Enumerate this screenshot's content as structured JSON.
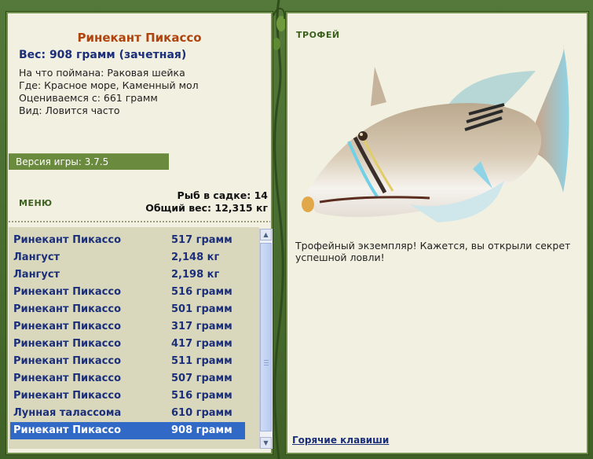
{
  "fish": {
    "title": "Ринекант Пикассо",
    "weight_line": "Вес: 908 грамм (зачетная)",
    "bait": "На что поймана: Раковая шейка",
    "location": "Где: Красное море, Каменный мол",
    "valued_from": "Оцениваемся с: 661 грамм",
    "kind": "Вид: Ловится часто"
  },
  "version": "Версия игры: 3.7.5",
  "menu_label": "МЕНЮ",
  "stats": {
    "fish_in_cage": "Рыб в садке: 14",
    "total_weight": "Общий вес: 12,315 кг"
  },
  "catch_list": [
    {
      "name": "Ринекант Пикассо",
      "weight": "517 грамм"
    },
    {
      "name": "Лангуст",
      "weight": "2,148 кг"
    },
    {
      "name": "Лангуст",
      "weight": "2,198 кг"
    },
    {
      "name": "Ринекант Пикассо",
      "weight": "516 грамм"
    },
    {
      "name": "Ринекант Пикассо",
      "weight": "501 грамм"
    },
    {
      "name": "Ринекант Пикассо",
      "weight": "317 грамм"
    },
    {
      "name": "Ринекант Пикассо",
      "weight": "417 грамм"
    },
    {
      "name": "Ринекант Пикассо",
      "weight": "511 грамм"
    },
    {
      "name": "Ринекант Пикассо",
      "weight": "507 грамм"
    },
    {
      "name": "Ринекант Пикассо",
      "weight": "516 грамм"
    },
    {
      "name": "Лунная талассома",
      "weight": "610 грамм"
    },
    {
      "name": "Ринекант Пикассо",
      "weight": "908 грамм"
    }
  ],
  "selected_index": 11,
  "trophy_label": "ТРОФЕЙ",
  "trophy_text": "Трофейный экземпляр! Кажется, вы открыли секрет успешной ловли!",
  "hotkeys_link": "Горячие клавиши",
  "icons": {
    "scroll_up": "scroll-up-icon",
    "scroll_down": "scroll-down-icon"
  },
  "colors": {
    "frame": "#4b6e2e",
    "panel": "#f1f0e1",
    "selection": "#3169c6",
    "title": "#b0440f",
    "navy": "#1c2f7a"
  }
}
